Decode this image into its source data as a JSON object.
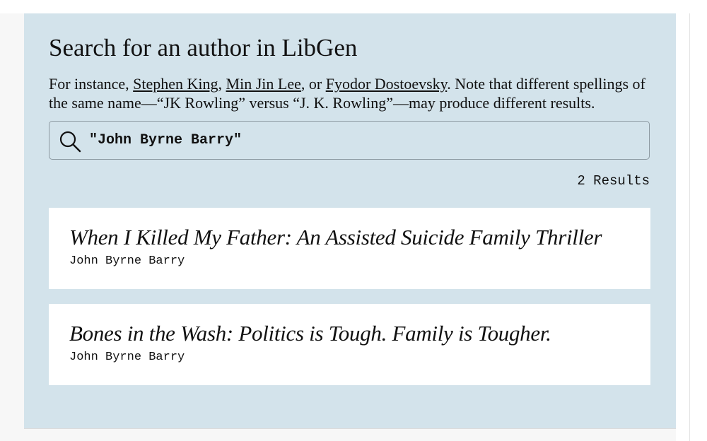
{
  "search": {
    "heading": "Search for an author in LibGen",
    "intro_prefix": "For instance, ",
    "examples": [
      "Stephen King",
      "Min Jin Lee",
      "Fyodor Dostoevsky"
    ],
    "sep_comma": ", ",
    "sep_or": ", or ",
    "intro_suffix": ". Note that different spellings of the same name—“JK Rowling” versus “J. K. Rowling”—may produce different results.",
    "query": "\"John Byrne Barry\"",
    "icon": "search-icon"
  },
  "results": {
    "count_label": "2 Results",
    "items": [
      {
        "title": "When I Killed My Father: An Assisted Suicide Family Thriller",
        "author": "John Byrne Barry"
      },
      {
        "title": "Bones in the Wash: Politics is Tough. Family is Tougher.",
        "author": "John Byrne Barry"
      }
    ]
  }
}
